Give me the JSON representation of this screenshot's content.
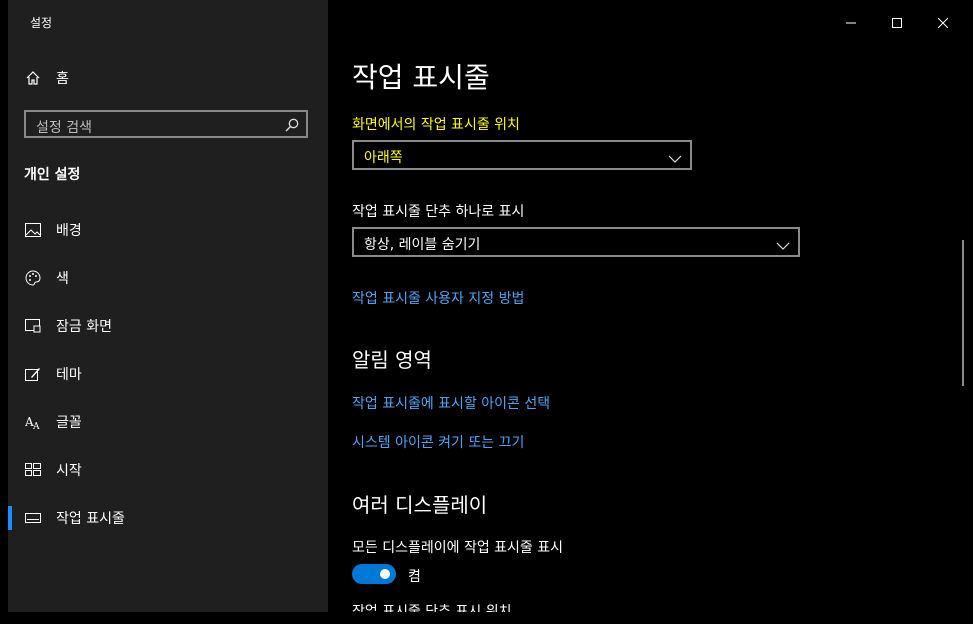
{
  "window": {
    "title": "설정"
  },
  "sidebar": {
    "home_label": "홈",
    "search_placeholder": "설정 검색",
    "section_title": "개인 설정",
    "items": [
      {
        "label": "배경",
        "icon": "image-icon"
      },
      {
        "label": "색",
        "icon": "palette-icon"
      },
      {
        "label": "잠금 화면",
        "icon": "lock-screen-icon"
      },
      {
        "label": "테마",
        "icon": "theme-icon"
      },
      {
        "label": "글꼴",
        "icon": "font-icon"
      },
      {
        "label": "시작",
        "icon": "start-icon"
      },
      {
        "label": "작업 표시줄",
        "icon": "taskbar-icon",
        "selected": true
      }
    ]
  },
  "main": {
    "title": "작업 표시줄",
    "taskbar_location": {
      "label": "화면에서의 작업 표시줄 위치",
      "value": "아래쪽"
    },
    "combine_buttons": {
      "label": "작업 표시줄 단추 하나로 표시",
      "value": "항상, 레이블 숨기기"
    },
    "customize_link": "작업 표시줄 사용자 지정 방법",
    "notification_area": {
      "title": "알림 영역",
      "links": [
        "작업 표시줄에 표시할 아이콘 선택",
        "시스템 아이콘 켜기 또는 끄기"
      ]
    },
    "multiple_displays": {
      "title": "여러 디스플레이",
      "show_on_all_label": "모든 디스플레이에 작업 표시줄 표시",
      "toggle_state": "켬",
      "next_label_partial": "작업 표시줄 단추 표시 위치"
    }
  },
  "colors": {
    "accent": "#0078d7",
    "highlight_text": "#ffff00",
    "link": "#4ea4f3",
    "sidebar_bg": "#1f1f1f"
  }
}
